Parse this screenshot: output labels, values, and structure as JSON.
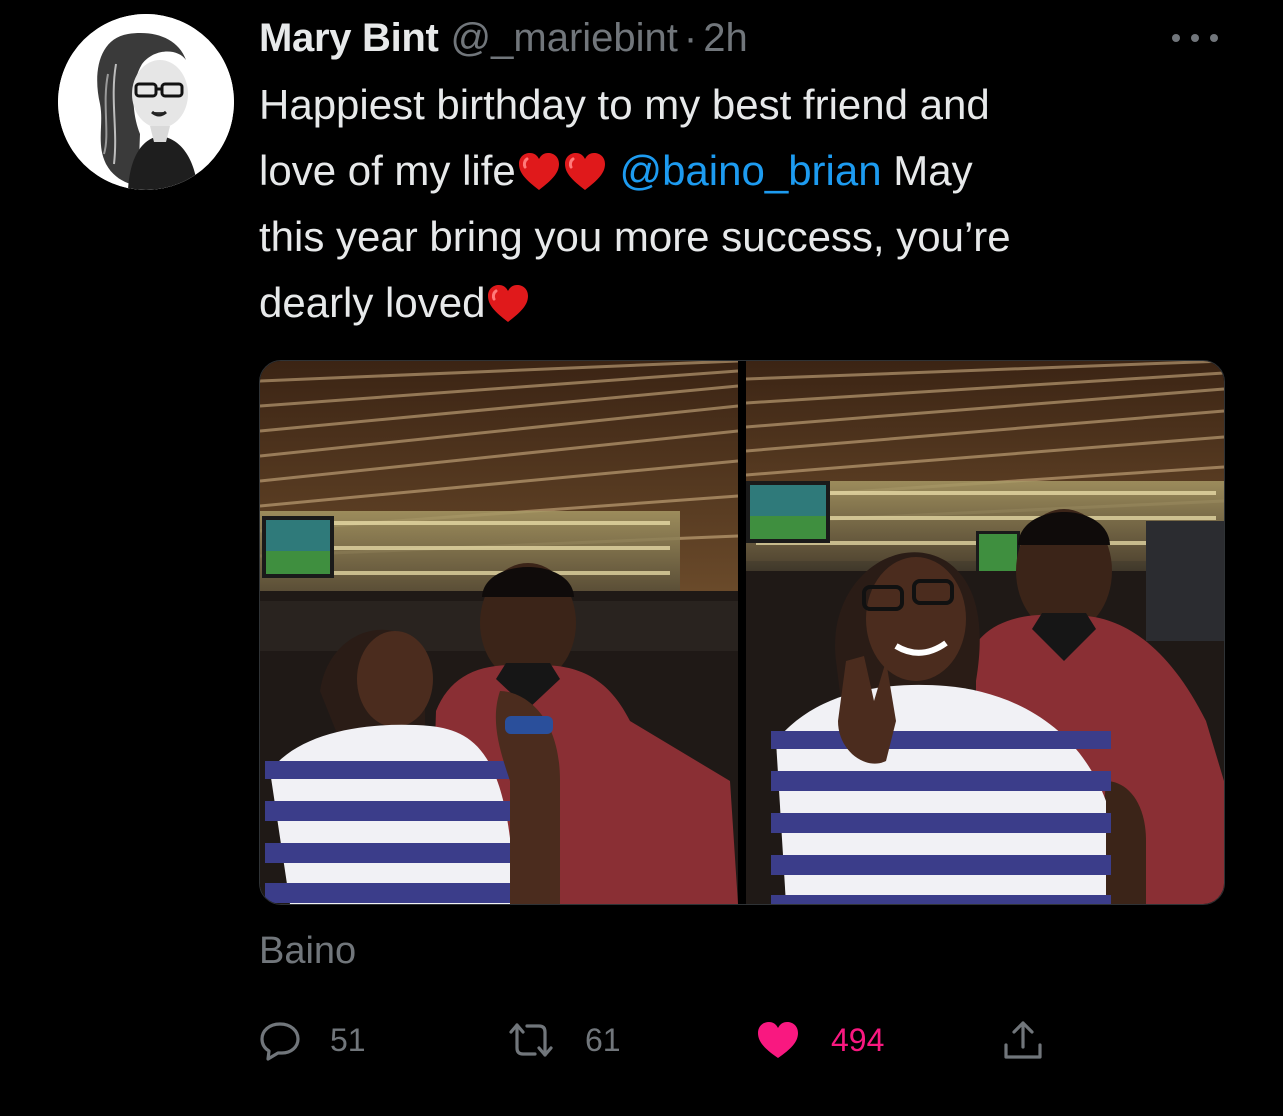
{
  "tweet": {
    "author": {
      "display_name": "Mary Bint",
      "handle": "@_mariebint",
      "separator": "·",
      "time": "2h",
      "avatar_icon": "cartoon-woman-avatar"
    },
    "more_icon": "ellipsis-icon",
    "text": {
      "line1": "Happiest birthday to my best friend and",
      "line2_start": "love of my life",
      "mention": "@baino_brian",
      "line2_end": " May",
      "line3": "this year bring you more success, you’re",
      "line4": "dearly loved"
    },
    "media": [
      {
        "description": "photo-couple-kiss-bar"
      },
      {
        "description": "photo-couple-smile-bar"
      }
    ],
    "location": "Baino",
    "actions": {
      "reply_count": "51",
      "retweet_count": "61",
      "like_count": "494"
    },
    "colors": {
      "background": "#000000",
      "text": "#e7e9ea",
      "secondary": "#71767b",
      "link": "#1d9bf0",
      "like": "#f91880"
    }
  }
}
